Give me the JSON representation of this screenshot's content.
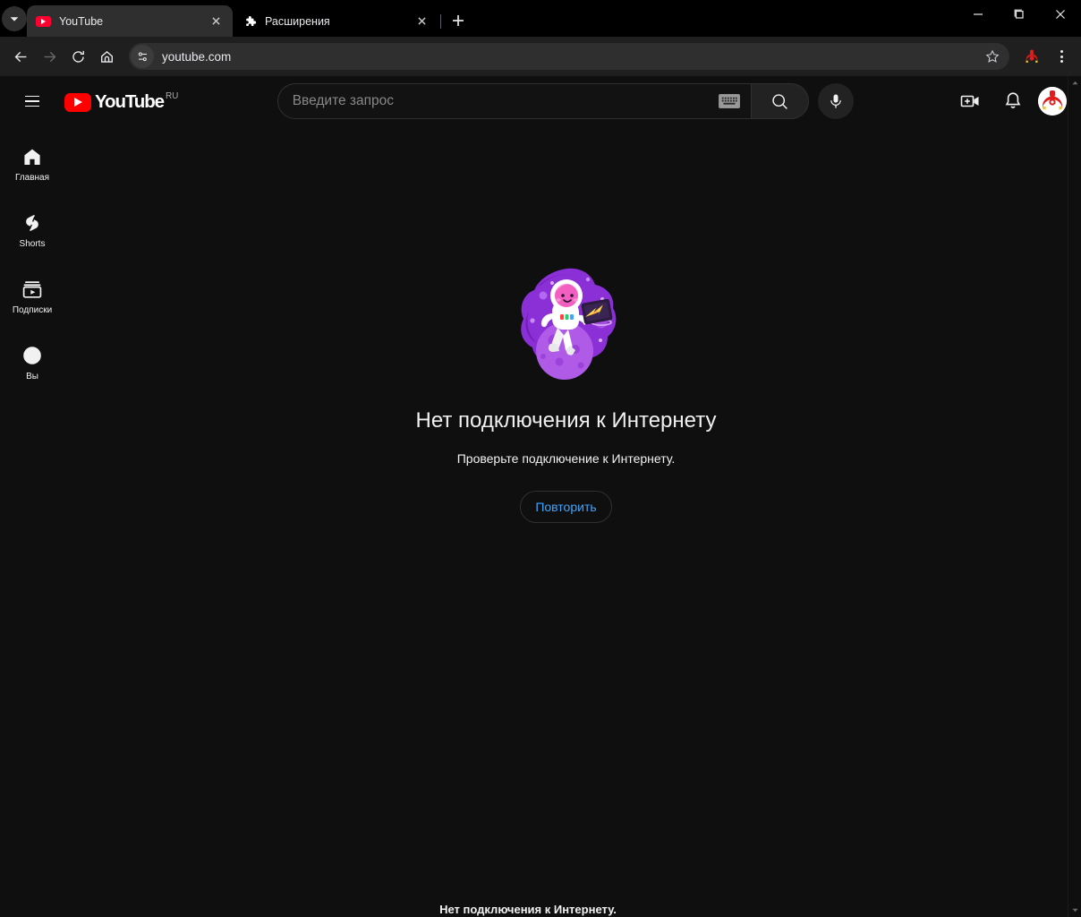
{
  "browser": {
    "tab_search_icon": "chevron-down-icon",
    "tabs": [
      {
        "title": "YouTube",
        "favicon": "youtube-favicon",
        "active": true,
        "close_icon": "close-icon"
      },
      {
        "title": "Расширения",
        "favicon": "puzzle-piece-icon",
        "active": false,
        "close_icon": "close-icon"
      }
    ],
    "new_tab_label": "+",
    "window_controls": {
      "minimize": "minimize-icon",
      "maximize": "maximize-icon",
      "close": "close-icon"
    },
    "toolbar": {
      "back_icon": "back-arrow-icon",
      "forward_icon": "forward-arrow-icon",
      "reload_icon": "reload-icon",
      "home_icon": "home-icon",
      "site_info_icon": "site-settings-icon",
      "url": "youtube.com",
      "bookmark_icon": "star-icon",
      "profile_icon": "profile-avatar-icon",
      "menu_icon": "three-dot-menu-icon"
    },
    "theme": {
      "titlebar_bg": "#000000",
      "tab_active_bg": "#2f2f2f",
      "toolbar_bg": "#1f1f1f",
      "omnibox_bg": "#2f2f2f"
    }
  },
  "youtube": {
    "masthead": {
      "menu_icon": "hamburger-menu-icon",
      "logo_text": "YouTube",
      "logo_country": "RU",
      "search_placeholder": "Введите запрос",
      "search_value": "",
      "keyboard_icon": "keyboard-icon",
      "search_icon": "search-icon",
      "mic_icon": "microphone-icon",
      "create_icon": "create-video-icon",
      "notifications_icon": "bell-icon",
      "avatar_icon": "account-avatar"
    },
    "sidebar": {
      "items": [
        {
          "label": "Главная",
          "icon": "home-icon",
          "active": true
        },
        {
          "label": "Shorts",
          "icon": "shorts-icon",
          "active": false
        },
        {
          "label": "Подписки",
          "icon": "subscriptions-icon",
          "active": false
        },
        {
          "label": "Вы",
          "icon": "you-account-icon",
          "active": false
        }
      ]
    },
    "error": {
      "illustration": "astronaut-on-planet-illustration",
      "title": "Нет подключения к Интернету",
      "subtitle": "Проверьте подключение к Интернету.",
      "retry_label": "Повторить",
      "bottom_status": "Нет подключения к Интернету.",
      "accent_color": "#3ea6ff"
    },
    "scrollbar": {
      "up_icon": "scroll-up-arrow",
      "down_icon": "scroll-down-arrow"
    },
    "theme": {
      "page_bg": "#0f0f0f",
      "text_primary": "#f1f1f1",
      "text_secondary": "#aaaaaa",
      "brand_red": "#ff0000"
    }
  }
}
